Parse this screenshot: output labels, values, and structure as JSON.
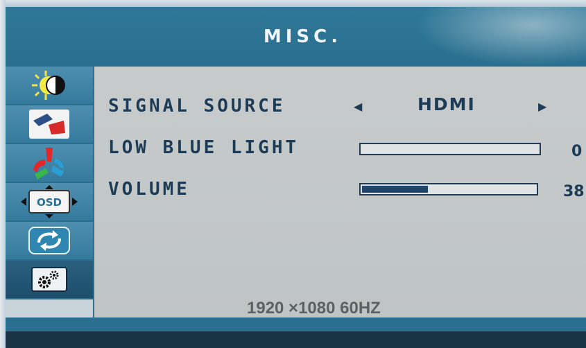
{
  "osd": {
    "title": "MISC.",
    "sidebar_tabs": [
      {
        "name": "brightness-contrast",
        "icon": "brightness-contrast-icon"
      },
      {
        "name": "image",
        "icon": "image-icon"
      },
      {
        "name": "color",
        "icon": "color-icon"
      },
      {
        "name": "osd",
        "icon": "osd-icon",
        "icon_text": "OSD"
      },
      {
        "name": "reset",
        "icon": "reset-icon"
      },
      {
        "name": "misc",
        "icon": "gears-icon",
        "active": true
      }
    ],
    "signal_source": {
      "label": "SIGNAL SOURCE",
      "value": "HDMI",
      "left_arrow": "◀",
      "right_arrow": "▶"
    },
    "low_blue_light": {
      "label": "LOW BLUE LIGHT",
      "value": 0,
      "value_text": "0",
      "max": 100
    },
    "volume": {
      "label": "VOLUME",
      "value": 38,
      "value_text": "38",
      "max": 100
    },
    "resolution": "1920 ×1080 60HZ"
  },
  "colors": {
    "panel_blue": "#2a6f8f",
    "content_gray": "#c4c8c8",
    "text_navy": "#1e3b56",
    "bar_fill": "#1f4468"
  }
}
